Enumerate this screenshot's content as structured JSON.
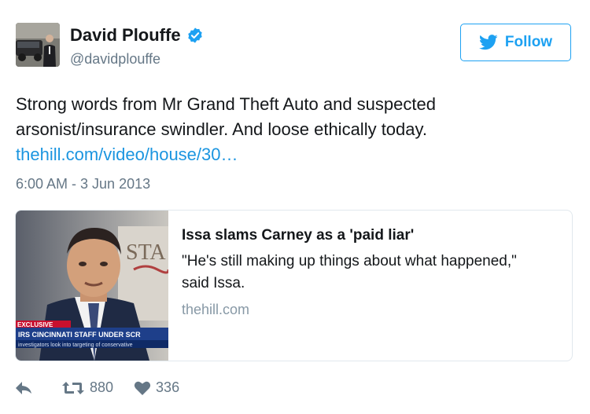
{
  "user": {
    "display_name": "David Plouffe",
    "handle": "@davidplouffe",
    "verified": true
  },
  "follow_button": {
    "label": "Follow",
    "icon": "twitter-bird-icon"
  },
  "tweet": {
    "text": "Strong words from Mr Grand Theft Auto and suspected arsonist/insurance swindler. And loose ethically today.",
    "link_text": "thehill.com/video/house/30…",
    "timestamp": "6:00 AM - 3 Jun 2013"
  },
  "card": {
    "title": "Issa slams Carney as a 'paid liar'",
    "description": "\"He's still making up things about what happened,\" said Issa.",
    "domain": "thehill.com",
    "image_text": {
      "background_sign": "STA",
      "banner_tag": "EXCLUSIVE",
      "ticker_headline": "IRS CINCINNATI STAFF UNDER SCR",
      "ticker_subline": "investigators look into targeting of conservative"
    }
  },
  "actions": {
    "reply_icon": "reply-icon",
    "retweet_icon": "retweet-icon",
    "retweet_count": "880",
    "like_icon": "heart-icon",
    "like_count": "336"
  },
  "colors": {
    "twitter_blue": "#1da1f2",
    "link": "#1b95e0",
    "secondary_text": "#657786",
    "border": "#e1e8ed"
  }
}
